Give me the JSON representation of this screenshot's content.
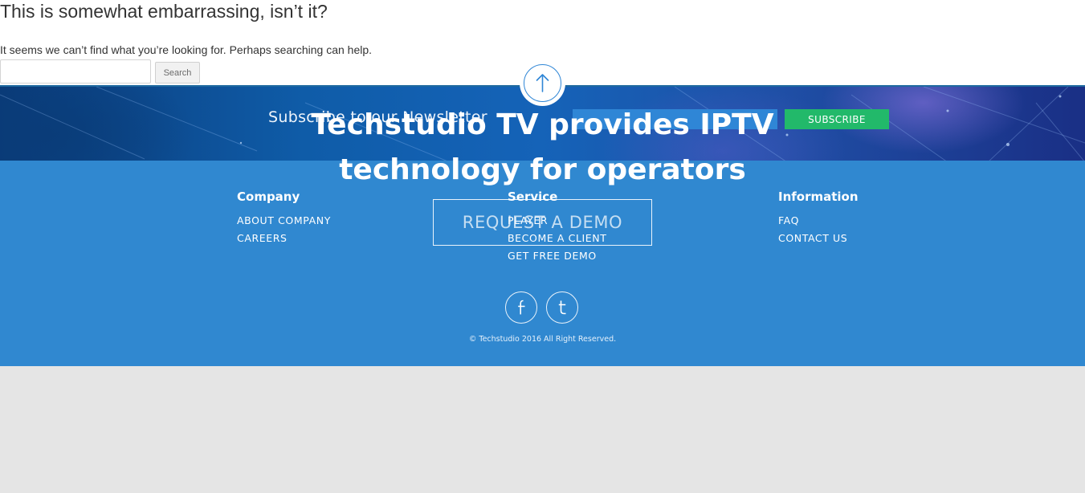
{
  "content": {
    "title": "This is somewhat embarrassing, isn’t it?",
    "message": "It seems we can’t find what you’re looking for. Perhaps searching can help.",
    "search": {
      "value": "",
      "placeholder": "",
      "button_label": "Search"
    }
  },
  "newsletter": {
    "heading": "Subscribe to our Newsletter",
    "email_value": "",
    "subscribe_label": "SUBSCRIBE"
  },
  "hero": {
    "line1": "Techstudio TV provides IPTV",
    "line2": "technology for operators",
    "cta_label": "REQUEST A DEMO"
  },
  "footer": {
    "columns": [
      {
        "heading": "Company",
        "links": [
          "ABOUT COMPANY",
          "CAREERS"
        ]
      },
      {
        "heading": "Service",
        "links": [
          "PLAYER",
          "BECOME A CLIENT",
          "GET FREE DEMO"
        ]
      },
      {
        "heading": "Information",
        "links": [
          "FAQ",
          "CONTACT US"
        ]
      }
    ],
    "social": [
      {
        "icon": "facebook-icon",
        "glyph": "f"
      },
      {
        "icon": "twitter-icon",
        "glyph": "t"
      }
    ],
    "copyright": "© Techstudio 2016 All Right Reserved."
  },
  "colors": {
    "footer_background": "#3088d0",
    "subscribe_button": "#22b96a",
    "newsletter_input": "#2f86d6",
    "page_background": "#e5e5e5",
    "text_dark": "#333333"
  },
  "icons": {
    "scroll_top": "arrow-up-icon"
  }
}
